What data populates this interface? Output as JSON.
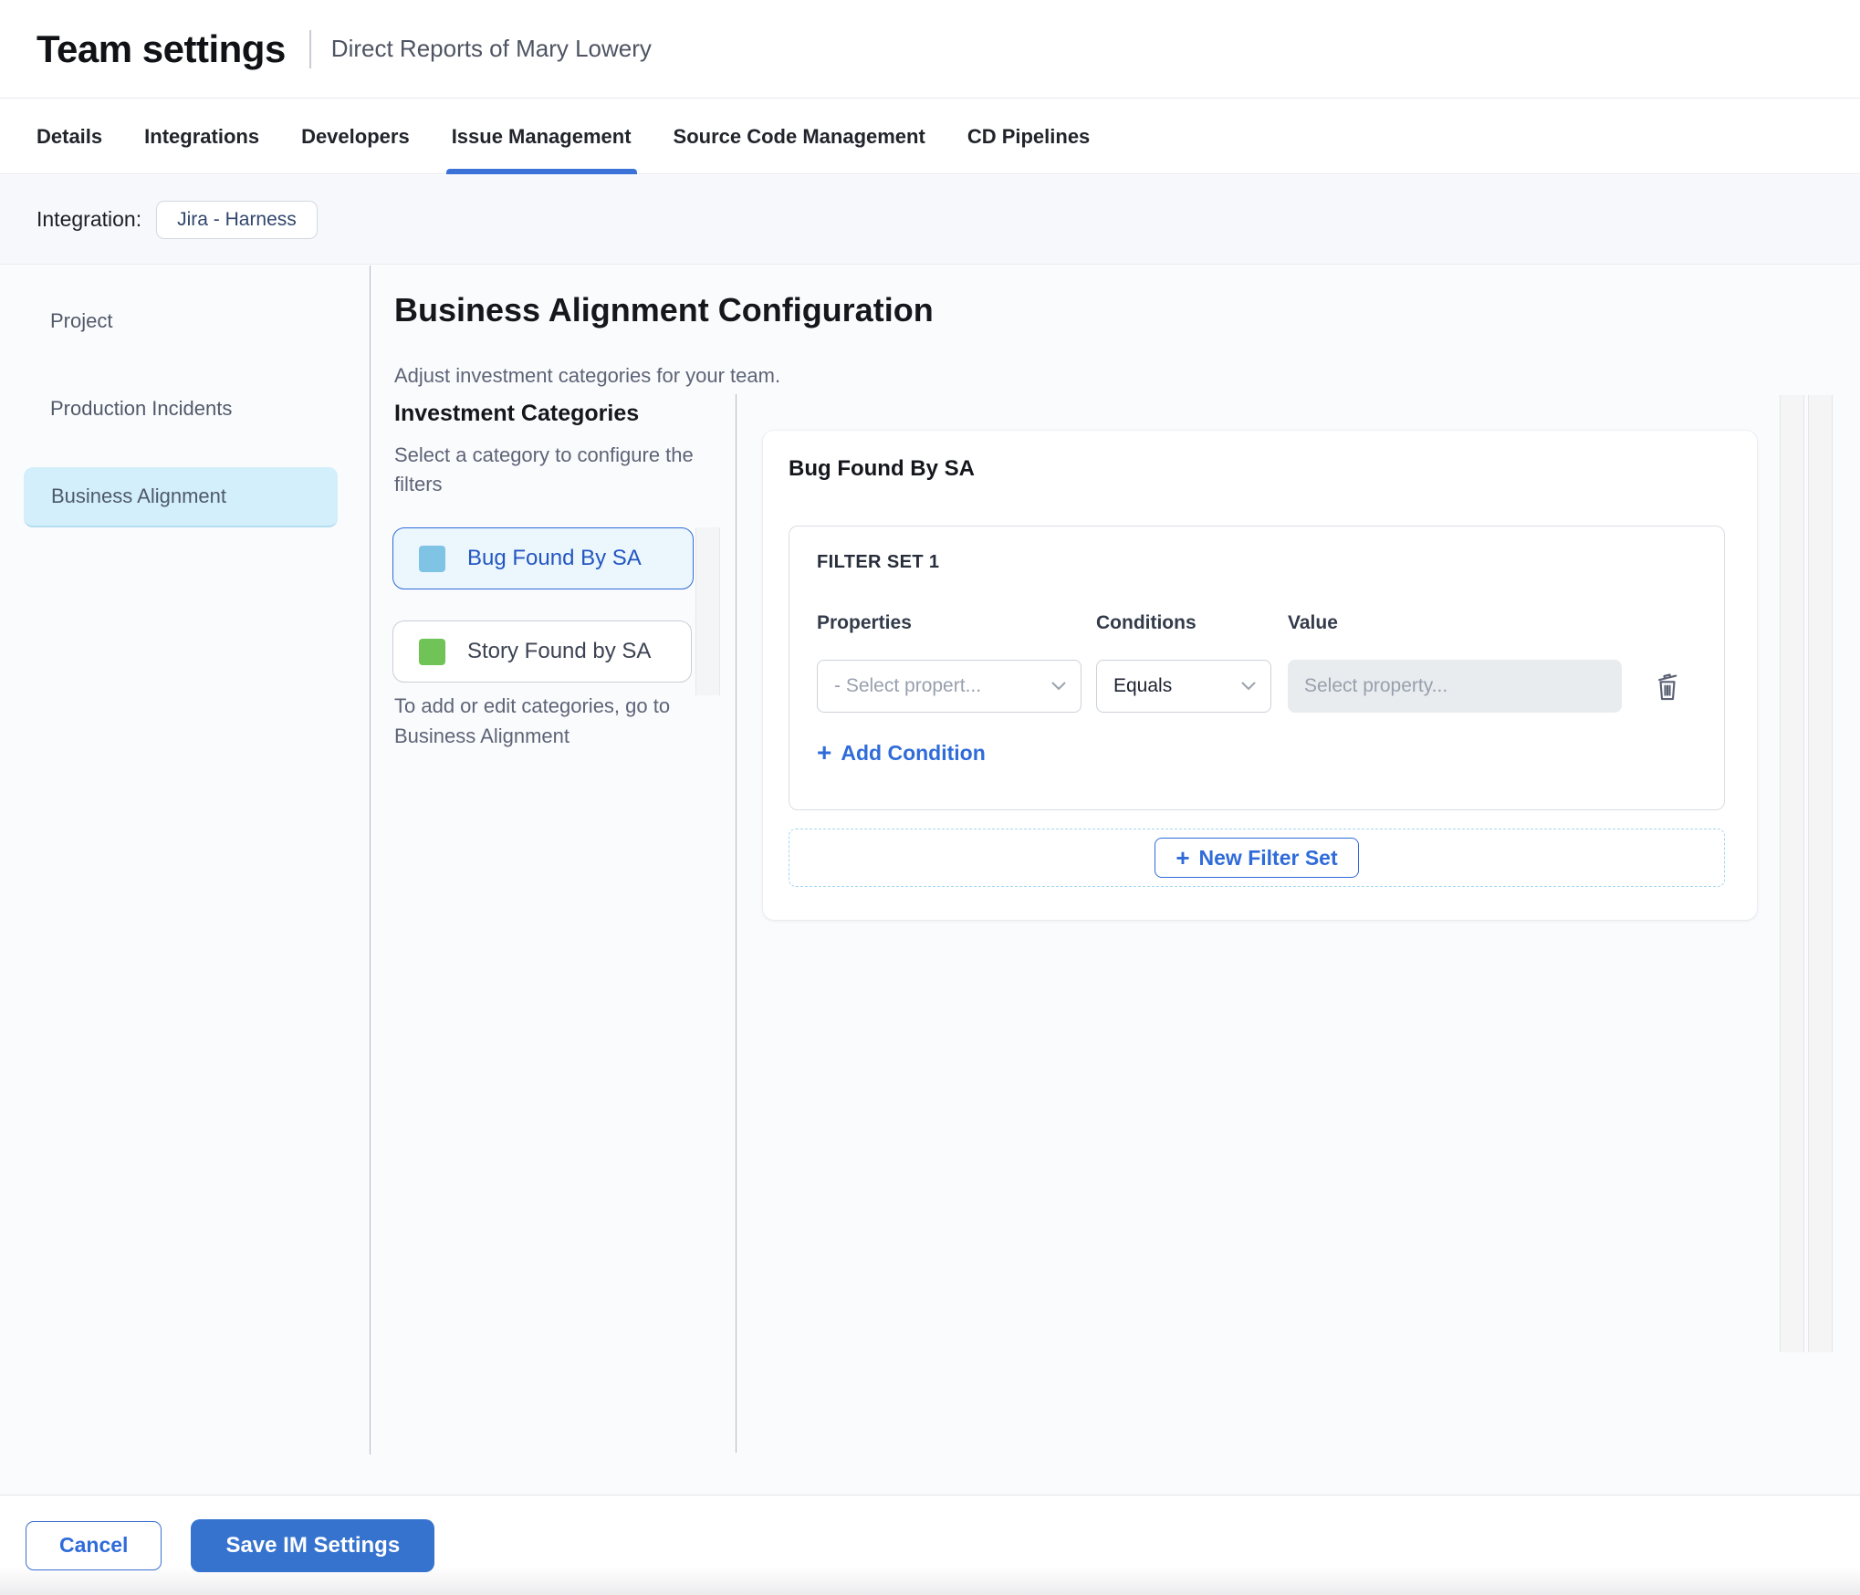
{
  "header": {
    "title": "Team settings",
    "subtitle": "Direct Reports of Mary Lowery"
  },
  "tabs": {
    "items": [
      {
        "label": "Details",
        "active": false
      },
      {
        "label": "Integrations",
        "active": false
      },
      {
        "label": "Developers",
        "active": false
      },
      {
        "label": "Issue Management",
        "active": true
      },
      {
        "label": "Source Code Management",
        "active": false
      },
      {
        "label": "CD Pipelines",
        "active": false
      }
    ]
  },
  "integration_bar": {
    "label": "Integration:",
    "chip": "Jira - Harness"
  },
  "sidebar": {
    "items": [
      {
        "label": "Project",
        "active": false
      },
      {
        "label": "Production Incidents",
        "active": false
      },
      {
        "label": "Business Alignment",
        "active": true
      }
    ]
  },
  "main": {
    "title": "Business Alignment Configuration",
    "subtitle": "Adjust investment categories for your team.",
    "categories": {
      "title": "Investment Categories",
      "hint_line1": "Select a category to configure the",
      "hint_line2": "filters",
      "items": [
        {
          "label": "Bug Found By SA",
          "swatch": "#7fc4e5",
          "selected": true
        },
        {
          "label": "Story Found by SA",
          "swatch": "#70c356",
          "selected": false
        }
      ],
      "note_line1": "To add or edit categories, go to",
      "note_line2": "Business Alignment"
    }
  },
  "panel": {
    "title": "Bug Found By SA",
    "filter_set": {
      "title": "FILTER SET 1",
      "columns": {
        "properties": "Properties",
        "conditions": "Conditions",
        "value": "Value"
      },
      "property_select_value": "- Select propert...",
      "condition_select_value": "Equals",
      "value_placeholder": "Select property...",
      "add_condition_label": "Add Condition"
    },
    "new_filter_set_label": "New Filter Set"
  },
  "footer": {
    "cancel_label": "Cancel",
    "save_label": "Save IM Settings"
  },
  "icons": {
    "plus": "+"
  },
  "colors": {
    "accent_blue": "#2f6bd9",
    "save_button_blue": "#3673cf",
    "active_tab_underline": "#3b72d8",
    "sidebar_active_bg": "#d3effb",
    "selected_category_bg": "#ecf7fd",
    "selected_category_text": "#2456c2",
    "bug_swatch": "#7fc4e5",
    "story_swatch": "#70c356",
    "disabled_input_bg": "#e8ecef",
    "dashed_border": "#a5d7ef"
  }
}
